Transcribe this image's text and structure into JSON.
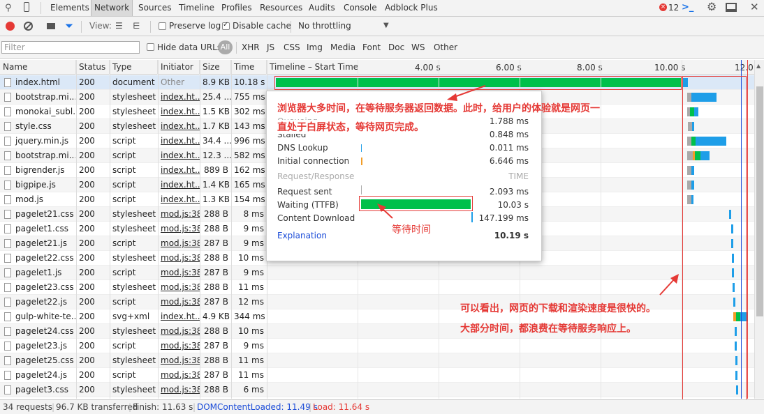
{
  "tabs": [
    "Elements",
    "Network",
    "Sources",
    "Timeline",
    "Profiles",
    "Resources",
    "Audits",
    "Console",
    "Adblock Plus"
  ],
  "error_count": "12",
  "toolbar": {
    "view_label": "View:",
    "preserve_log": "Preserve log",
    "disable_cache": "Disable cache",
    "throttle": "No throttling"
  },
  "filterbar": {
    "placeholder": "Filter",
    "hide_data_urls": "Hide data URLs",
    "all": "All",
    "types": [
      "XHR",
      "JS",
      "CSS",
      "Img",
      "Media",
      "Font",
      "Doc",
      "WS",
      "Other"
    ]
  },
  "columns": {
    "name": "Name",
    "status": "Status",
    "type": "Type",
    "initiator": "Initiator",
    "size": "Size",
    "time": "Time",
    "timeline": "Timeline – Start Time"
  },
  "ticks": [
    "4.00 s",
    "6.00 s",
    "8.00 s",
    "10.00 s",
    "12.0"
  ],
  "rows": [
    {
      "name": "index.html",
      "status": "200",
      "type": "document",
      "initiator": "Other",
      "size": "8.9 KB",
      "time": "10.18 s"
    },
    {
      "name": "bootstrap.mi...",
      "status": "200",
      "type": "stylesheet",
      "initiator": "index.ht...",
      "size": "25.4 ...",
      "time": "755 ms"
    },
    {
      "name": "monokai_subl...",
      "status": "200",
      "type": "stylesheet",
      "initiator": "index.ht...",
      "size": "1.5 KB",
      "time": "302 ms"
    },
    {
      "name": "style.css",
      "status": "200",
      "type": "stylesheet",
      "initiator": "index.ht...",
      "size": "1.7 KB",
      "time": "143 ms"
    },
    {
      "name": "jquery.min.js",
      "status": "200",
      "type": "script",
      "initiator": "index.ht...",
      "size": "34.4 ...",
      "time": "996 ms"
    },
    {
      "name": "bootstrap.mi...",
      "status": "200",
      "type": "script",
      "initiator": "index.ht...",
      "size": "12.3 ...",
      "time": "582 ms"
    },
    {
      "name": "bigrender.js",
      "status": "200",
      "type": "script",
      "initiator": "index.ht...",
      "size": "889 B",
      "time": "162 ms"
    },
    {
      "name": "bigpipe.js",
      "status": "200",
      "type": "script",
      "initiator": "index.ht...",
      "size": "1.4 KB",
      "time": "165 ms"
    },
    {
      "name": "mod.js",
      "status": "200",
      "type": "script",
      "initiator": "index.ht...",
      "size": "1.3 KB",
      "time": "154 ms"
    },
    {
      "name": "pagelet21.css",
      "status": "200",
      "type": "stylesheet",
      "initiator": "mod.js:38",
      "size": "288 B",
      "time": "8 ms"
    },
    {
      "name": "pagelet1.css",
      "status": "200",
      "type": "stylesheet",
      "initiator": "mod.js:38",
      "size": "288 B",
      "time": "9 ms"
    },
    {
      "name": "pagelet21.js",
      "status": "200",
      "type": "script",
      "initiator": "mod.js:38",
      "size": "287 B",
      "time": "9 ms"
    },
    {
      "name": "pagelet22.css",
      "status": "200",
      "type": "stylesheet",
      "initiator": "mod.js:38",
      "size": "288 B",
      "time": "10 ms"
    },
    {
      "name": "pagelet1.js",
      "status": "200",
      "type": "script",
      "initiator": "mod.js:38",
      "size": "287 B",
      "time": "9 ms"
    },
    {
      "name": "pagelet23.css",
      "status": "200",
      "type": "stylesheet",
      "initiator": "mod.js:38",
      "size": "288 B",
      "time": "11 ms"
    },
    {
      "name": "pagelet22.js",
      "status": "200",
      "type": "script",
      "initiator": "mod.js:38",
      "size": "287 B",
      "time": "12 ms"
    },
    {
      "name": "gulp-white-te...",
      "status": "200",
      "type": "svg+xml",
      "initiator": "index.ht...",
      "size": "4.9 KB",
      "time": "344 ms"
    },
    {
      "name": "pagelet24.css",
      "status": "200",
      "type": "stylesheet",
      "initiator": "mod.js:38",
      "size": "288 B",
      "time": "10 ms"
    },
    {
      "name": "pagelet23.js",
      "status": "200",
      "type": "script",
      "initiator": "mod.js:38",
      "size": "287 B",
      "time": "9 ms"
    },
    {
      "name": "pagelet25.css",
      "status": "200",
      "type": "stylesheet",
      "initiator": "mod.js:38",
      "size": "288 B",
      "time": "11 ms"
    },
    {
      "name": "pagelet24.js",
      "status": "200",
      "type": "script",
      "initiator": "mod.js:38",
      "size": "287 B",
      "time": "11 ms"
    },
    {
      "name": "pagelet3.css",
      "status": "200",
      "type": "stylesheet",
      "initiator": "mod.js:38",
      "size": "288 B",
      "time": "6 ms"
    }
  ],
  "popup": {
    "queueing_label": "Queueing",
    "queueing": "1.788 ms",
    "stalled_label": "Stalled",
    "stalled": "0.848 ms",
    "dns_label": "DNS Lookup",
    "dns": "0.011 ms",
    "conn_label": "Initial connection",
    "conn": "6.646 ms",
    "section": "Request/Response",
    "section_time": "TIME",
    "sent_label": "Request sent",
    "sent": "2.093 ms",
    "ttfb_label": "Waiting (TTFB)",
    "ttfb": "10.03 s",
    "download_label": "Content Download",
    "download": "147.199 ms",
    "explanation": "Explanation",
    "total": "10.19 s"
  },
  "notes": {
    "top1": "浏览器大多时间，在等待服务器返回数据。此时，给用户的体验就是网页一",
    "top2": "直处于白屏状态，等待网页完成。",
    "wait": "等待时间",
    "right1": "可以看出，网页的下载和渲染速度是很快的。",
    "right2": "大部分时间，都浪费在等待服务响应上。"
  },
  "status": {
    "requests": "34 requests",
    "transferred": "96.7 KB transferred",
    "finish": "Finish: 11.63 s",
    "dcl": "DOMContentLoaded: 11.49 s",
    "load": "Load: 11.64 s"
  },
  "colors": {
    "ttfb": "#00c04b",
    "download": "#1e9ee8",
    "stalled": "#a9a9a9",
    "connect": "#f29d28",
    "dcl": "#1a4bd8",
    "load": "#e53935",
    "annotation": "#e53935"
  }
}
